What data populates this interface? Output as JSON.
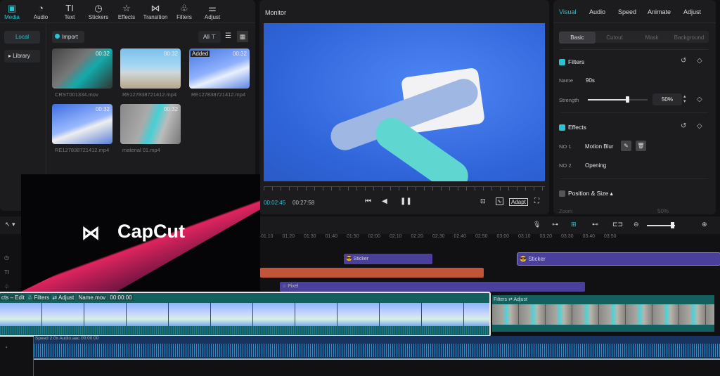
{
  "toolbar": {
    "items": [
      {
        "label": "Media",
        "icon": "media-icon"
      },
      {
        "label": "Audio",
        "icon": "audio-icon"
      },
      {
        "label": "Text",
        "icon": "text-icon"
      },
      {
        "label": "Stickers",
        "icon": "stickers-icon"
      },
      {
        "label": "Effects",
        "icon": "effects-icon"
      },
      {
        "label": "Transition",
        "icon": "transition-icon"
      },
      {
        "label": "Filters",
        "icon": "filters-icon"
      },
      {
        "label": "Adjust",
        "icon": "adjust-icon"
      }
    ]
  },
  "media": {
    "side": [
      "Local",
      "Library"
    ],
    "import": "Import",
    "filter": "All",
    "items": [
      {
        "name": "CRST001334.mov",
        "duration": "00:32",
        "badge": ""
      },
      {
        "name": "RE127838721412.mp4",
        "duration": "00:32",
        "badge": ""
      },
      {
        "name": "RE127838721412.mp4",
        "duration": "00:32",
        "badge": "Added"
      },
      {
        "name": "RE127838721412.mp4",
        "duration": "00:32",
        "badge": ""
      },
      {
        "name": "material 01.mp4",
        "duration": "00:32",
        "badge": ""
      }
    ]
  },
  "monitor": {
    "title": "Monitor",
    "current": "00:02:45",
    "total": "00:27:58",
    "adapt": "Adapt"
  },
  "inspector": {
    "tabs": [
      "Visual",
      "Audio",
      "Speed",
      "Animate",
      "Adjust"
    ],
    "subtabs": [
      "Basic",
      "Cutout",
      "Mask",
      "Background"
    ],
    "filters": {
      "title": "Filters",
      "name_label": "Name",
      "name": "90s",
      "strength_label": "Strength",
      "strength": "50%",
      "strength_value": 0.5
    },
    "effects": {
      "title": "Effects",
      "items": [
        {
          "no": "NO 1",
          "name": "Motion Blur"
        },
        {
          "no": "NO 2",
          "name": "Opening"
        }
      ]
    },
    "position": {
      "title": "Position & Size",
      "zoom_label": "Zoom",
      "zoom": "50%"
    }
  },
  "timeline": {
    "ticks": [
      "01:10",
      "01:20",
      "01:30",
      "01:40",
      "01:50",
      "02:00",
      "02:10",
      "02:20",
      "02:30",
      "02:40",
      "02:50",
      "03:00",
      "03:10",
      "03:20",
      "03:30",
      "03:40",
      "03:50"
    ],
    "sticker1": "Sticker",
    "sticker2": "Sticker",
    "pixel": "Pixel",
    "clip1": {
      "effects": "cts – Edit",
      "filters": "Filters",
      "adjust": "Adjust",
      "name": "Name.mov",
      "time": "00:00:00"
    },
    "clip2": {
      "filters": "Filters",
      "adjust": "Adjust"
    },
    "audio": {
      "speed": "Speed 2.0x",
      "name": "Audio.aac",
      "time": "00:00:00"
    }
  },
  "brand": {
    "name": "CapCut"
  },
  "colors": {
    "accent": "#2cc3d0",
    "sticker": "#4a3f9a",
    "orange": "#c0553a",
    "clip": "#14605f"
  }
}
